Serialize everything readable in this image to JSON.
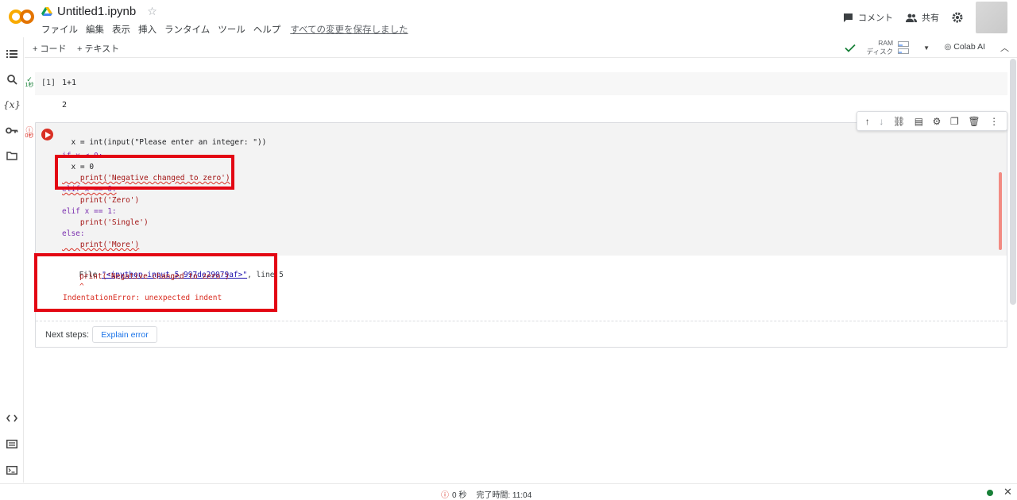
{
  "header": {
    "title": "Untitled1.ipynb",
    "menu": [
      "ファイル",
      "編集",
      "表示",
      "挿入",
      "ランタイム",
      "ツール",
      "ヘルプ"
    ],
    "saved_status": "すべての変更を保存しました",
    "comment_label": "コメント",
    "share_label": "共有"
  },
  "toolbar": {
    "add_code": "+ コード",
    "add_text": "+ テキスト",
    "ram_label": "RAM",
    "disk_label": "ディスク",
    "colab_ai": "Colab AI"
  },
  "cell1": {
    "status_time": "1秒",
    "exec_count": "[1]",
    "code": "1+1",
    "output": "2"
  },
  "cell2": {
    "status_time": "0秒",
    "code_lines": [
      "x = int(input(\"Please enter an integer: \"))",
      "",
      "if x < 0:",
      "  x = 0",
      "    print('Negative changed to zero')",
      "elif x == 0:",
      "    print('Zero')",
      "elif x == 1:",
      "    print('Single')",
      "else:",
      "    print('More')"
    ],
    "traceback": {
      "file_prefix": "File ",
      "file_link": "\"<ipython-input-5-997de29079af>\"",
      "file_suffix": ", line 5",
      "source_line": "print('Negative changed to zero')",
      "caret": "^",
      "error": "IndentationError: unexpected indent"
    }
  },
  "next_steps": {
    "label": "Next steps:",
    "explain_button": "Explain error"
  },
  "statusbar": {
    "time": "0 秒",
    "completed": "完了時間: 11:04"
  },
  "colors": {
    "highlight_red": "#e30613",
    "error_red": "#d93025",
    "success_green": "#188038",
    "link_blue": "#1a73e8"
  }
}
